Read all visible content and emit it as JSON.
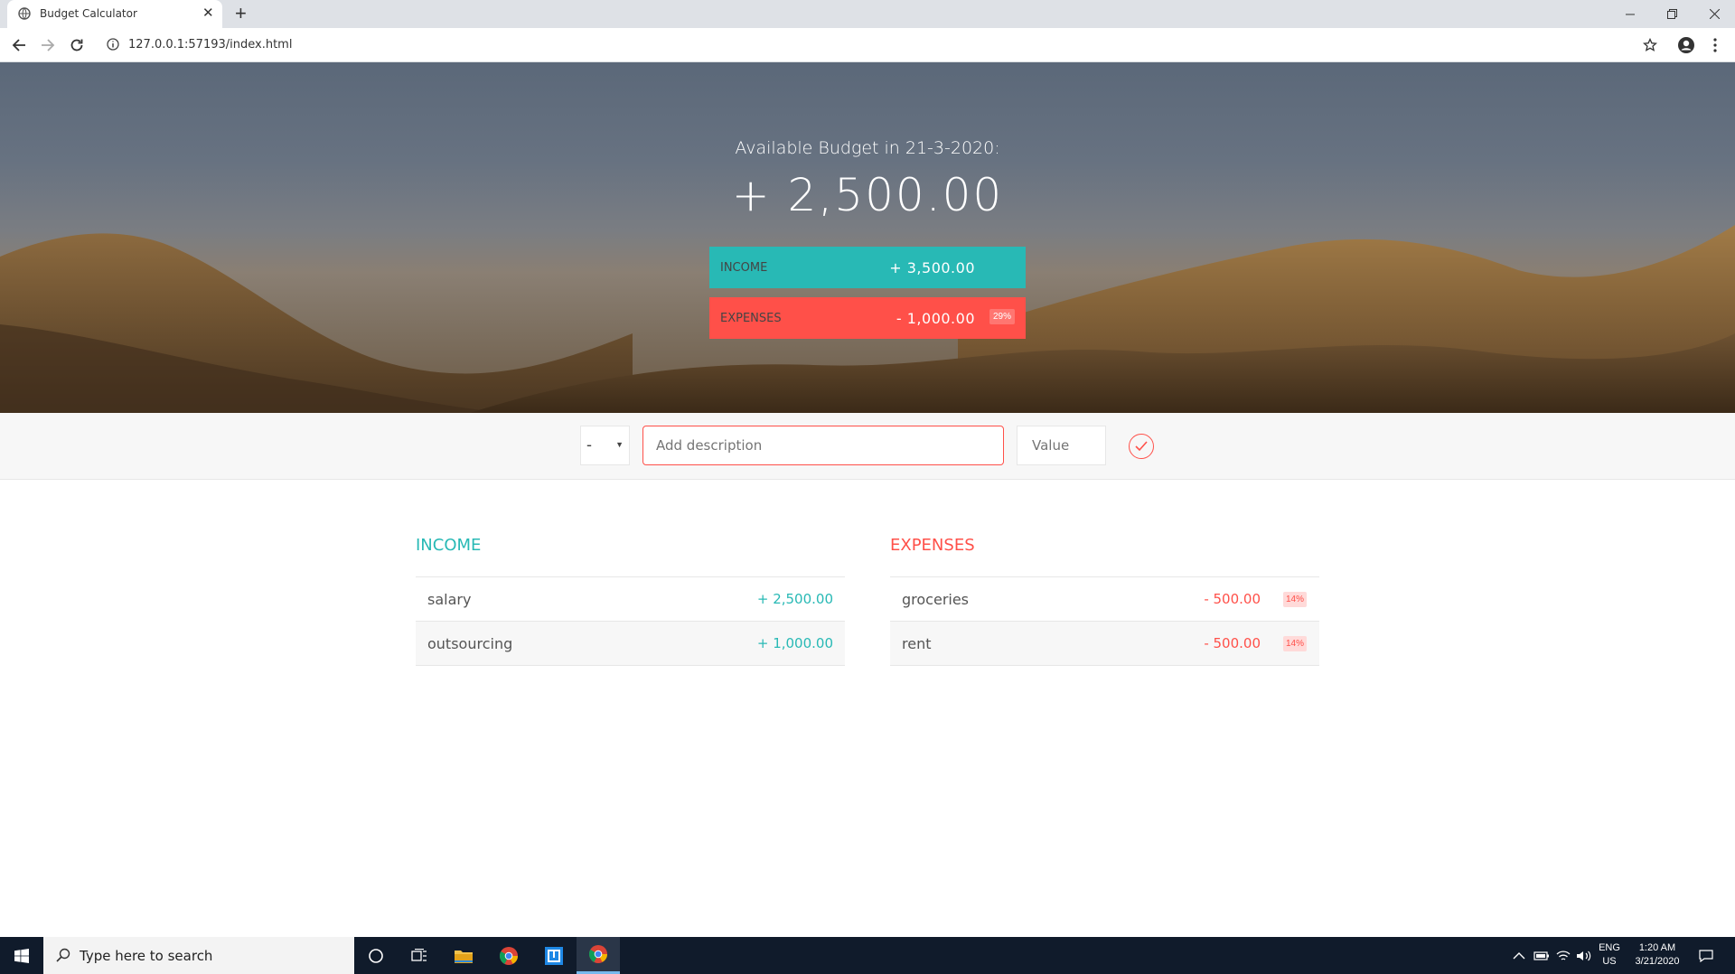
{
  "browser": {
    "tab_title": "Budget Calculator",
    "url": "127.0.0.1:57193/index.html"
  },
  "budget": {
    "title": "Available Budget in 21-3-2020:",
    "value": "+ 2,500.00",
    "income_label": "Income",
    "income_value": "+ 3,500.00",
    "expenses_label": "Expenses",
    "expenses_value": "- 1,000.00",
    "expenses_percentage": "29%"
  },
  "add_form": {
    "type_selected": "-",
    "description_placeholder": "Add description",
    "value_placeholder": "Value"
  },
  "income": {
    "title": "Income",
    "items": [
      {
        "description": "salary",
        "value": "+ 2,500.00"
      },
      {
        "description": "outsourcing",
        "value": "+ 1,000.00"
      }
    ]
  },
  "expenses": {
    "title": "Expenses",
    "items": [
      {
        "description": "groceries",
        "value": "- 500.00",
        "percentage": "14%"
      },
      {
        "description": "rent",
        "value": "- 500.00",
        "percentage": "14%"
      }
    ]
  },
  "taskbar": {
    "search_placeholder": "Type here to search",
    "lang_line1": "ENG",
    "lang_line2": "US",
    "time": "1:20 AM",
    "date": "3/21/2020"
  },
  "colors": {
    "income_accent": "#28b9b5",
    "expenses_accent": "#ff5049"
  }
}
